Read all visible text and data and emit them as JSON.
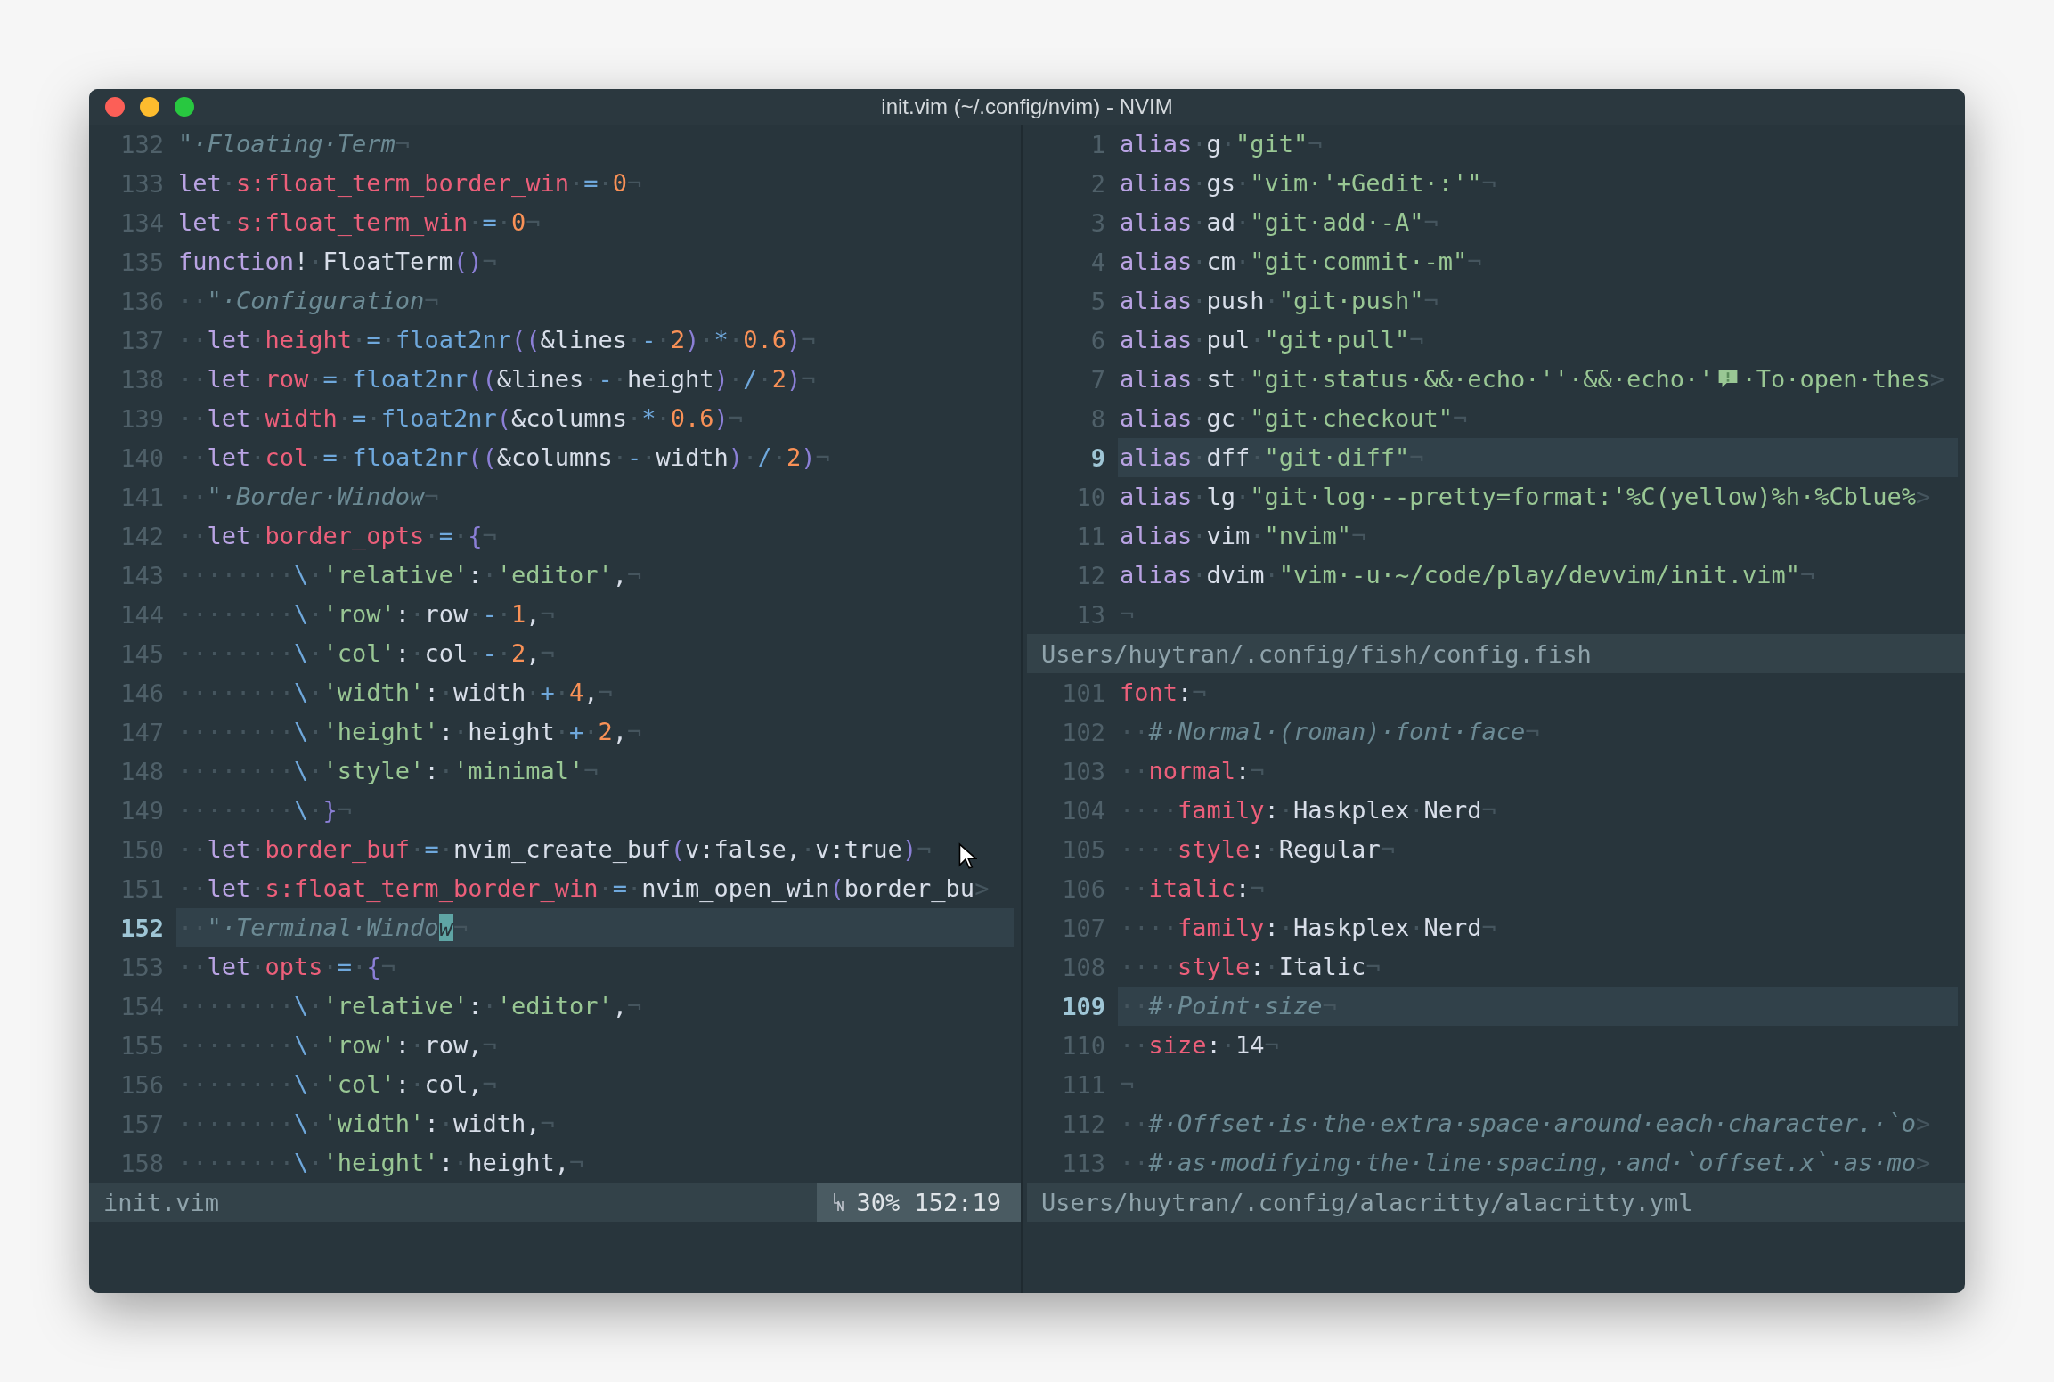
{
  "window": {
    "title": "init.vim (~/.config/nvim) - NVIM"
  },
  "left_pane": {
    "lines": [
      {
        "n": "132",
        "current": false,
        "c": [
          {
            "kind": "cmt",
            "text": "\"·Floating·Term"
          },
          {
            "kind": "ws",
            "text": "¬"
          }
        ]
      },
      {
        "n": "133",
        "current": false,
        "c": [
          {
            "kind": "kw",
            "text": "let"
          },
          {
            "kind": "ws",
            "text": "·"
          },
          {
            "kind": "var",
            "text": "s:float_term_border_win"
          },
          {
            "kind": "ws",
            "text": "·"
          },
          {
            "kind": "op",
            "text": "="
          },
          {
            "kind": "ws",
            "text": "·"
          },
          {
            "kind": "num",
            "text": "0"
          },
          {
            "kind": "ws",
            "text": "¬"
          }
        ]
      },
      {
        "n": "134",
        "current": false,
        "c": [
          {
            "kind": "kw",
            "text": "let"
          },
          {
            "kind": "ws",
            "text": "·"
          },
          {
            "kind": "var",
            "text": "s:float_term_win"
          },
          {
            "kind": "ws",
            "text": "·"
          },
          {
            "kind": "op",
            "text": "="
          },
          {
            "kind": "ws",
            "text": "·"
          },
          {
            "kind": "num",
            "text": "0"
          },
          {
            "kind": "ws",
            "text": "¬"
          }
        ]
      },
      {
        "n": "135",
        "current": false,
        "c": [
          {
            "kind": "kw",
            "text": "function"
          },
          {
            "kind": "tx",
            "text": "!"
          },
          {
            "kind": "ws",
            "text": "·"
          },
          {
            "kind": "tx",
            "text": "FloatTerm"
          },
          {
            "kind": "pn",
            "text": "()"
          },
          {
            "kind": "ws",
            "text": "¬"
          }
        ]
      },
      {
        "n": "136",
        "current": false,
        "c": [
          {
            "kind": "ws",
            "text": "··"
          },
          {
            "kind": "cmt",
            "text": "\"·Configuration"
          },
          {
            "kind": "ws",
            "text": "¬"
          }
        ]
      },
      {
        "n": "137",
        "current": false,
        "c": [
          {
            "kind": "ws",
            "text": "··"
          },
          {
            "kind": "kw",
            "text": "let"
          },
          {
            "kind": "ws",
            "text": "·"
          },
          {
            "kind": "var",
            "text": "height"
          },
          {
            "kind": "ws",
            "text": "·"
          },
          {
            "kind": "op",
            "text": "="
          },
          {
            "kind": "ws",
            "text": "·"
          },
          {
            "kind": "fn",
            "text": "float2nr"
          },
          {
            "kind": "pn",
            "text": "(("
          },
          {
            "kind": "tx",
            "text": "&lines"
          },
          {
            "kind": "ws",
            "text": "·"
          },
          {
            "kind": "op",
            "text": "-"
          },
          {
            "kind": "ws",
            "text": "·"
          },
          {
            "kind": "num",
            "text": "2"
          },
          {
            "kind": "pn",
            "text": ")"
          },
          {
            "kind": "ws",
            "text": "·"
          },
          {
            "kind": "op",
            "text": "*"
          },
          {
            "kind": "ws",
            "text": "·"
          },
          {
            "kind": "num",
            "text": "0.6"
          },
          {
            "kind": "pn",
            "text": ")"
          },
          {
            "kind": "ws",
            "text": "¬"
          }
        ]
      },
      {
        "n": "138",
        "current": false,
        "c": [
          {
            "kind": "ws",
            "text": "··"
          },
          {
            "kind": "kw",
            "text": "let"
          },
          {
            "kind": "ws",
            "text": "·"
          },
          {
            "kind": "var",
            "text": "row"
          },
          {
            "kind": "ws",
            "text": "·"
          },
          {
            "kind": "op",
            "text": "="
          },
          {
            "kind": "ws",
            "text": "·"
          },
          {
            "kind": "fn",
            "text": "float2nr"
          },
          {
            "kind": "pn",
            "text": "(("
          },
          {
            "kind": "tx",
            "text": "&lines"
          },
          {
            "kind": "ws",
            "text": "·"
          },
          {
            "kind": "op",
            "text": "-"
          },
          {
            "kind": "ws",
            "text": "·"
          },
          {
            "kind": "tx",
            "text": "height"
          },
          {
            "kind": "pn",
            "text": ")"
          },
          {
            "kind": "ws",
            "text": "·"
          },
          {
            "kind": "op",
            "text": "/"
          },
          {
            "kind": "ws",
            "text": "·"
          },
          {
            "kind": "num",
            "text": "2"
          },
          {
            "kind": "pn",
            "text": ")"
          },
          {
            "kind": "ws",
            "text": "¬"
          }
        ]
      },
      {
        "n": "139",
        "current": false,
        "c": [
          {
            "kind": "ws",
            "text": "··"
          },
          {
            "kind": "kw",
            "text": "let"
          },
          {
            "kind": "ws",
            "text": "·"
          },
          {
            "kind": "var",
            "text": "width"
          },
          {
            "kind": "ws",
            "text": "·"
          },
          {
            "kind": "op",
            "text": "="
          },
          {
            "kind": "ws",
            "text": "·"
          },
          {
            "kind": "fn",
            "text": "float2nr"
          },
          {
            "kind": "pn",
            "text": "("
          },
          {
            "kind": "tx",
            "text": "&columns"
          },
          {
            "kind": "ws",
            "text": "·"
          },
          {
            "kind": "op",
            "text": "*"
          },
          {
            "kind": "ws",
            "text": "·"
          },
          {
            "kind": "num",
            "text": "0.6"
          },
          {
            "kind": "pn",
            "text": ")"
          },
          {
            "kind": "ws",
            "text": "¬"
          }
        ]
      },
      {
        "n": "140",
        "current": false,
        "c": [
          {
            "kind": "ws",
            "text": "··"
          },
          {
            "kind": "kw",
            "text": "let"
          },
          {
            "kind": "ws",
            "text": "·"
          },
          {
            "kind": "var",
            "text": "col"
          },
          {
            "kind": "ws",
            "text": "·"
          },
          {
            "kind": "op",
            "text": "="
          },
          {
            "kind": "ws",
            "text": "·"
          },
          {
            "kind": "fn",
            "text": "float2nr"
          },
          {
            "kind": "pn",
            "text": "(("
          },
          {
            "kind": "tx",
            "text": "&columns"
          },
          {
            "kind": "ws",
            "text": "·"
          },
          {
            "kind": "op",
            "text": "-"
          },
          {
            "kind": "ws",
            "text": "·"
          },
          {
            "kind": "tx",
            "text": "width"
          },
          {
            "kind": "pn",
            "text": ")"
          },
          {
            "kind": "ws",
            "text": "·"
          },
          {
            "kind": "op",
            "text": "/"
          },
          {
            "kind": "ws",
            "text": "·"
          },
          {
            "kind": "num",
            "text": "2"
          },
          {
            "kind": "pn",
            "text": ")"
          },
          {
            "kind": "ws",
            "text": "¬"
          }
        ]
      },
      {
        "n": "141",
        "current": false,
        "c": [
          {
            "kind": "ws",
            "text": "··"
          },
          {
            "kind": "cmt",
            "text": "\"·Border·Window"
          },
          {
            "kind": "ws",
            "text": "¬"
          }
        ]
      },
      {
        "n": "142",
        "current": false,
        "c": [
          {
            "kind": "ws",
            "text": "··"
          },
          {
            "kind": "kw",
            "text": "let"
          },
          {
            "kind": "ws",
            "text": "·"
          },
          {
            "kind": "var",
            "text": "border_opts"
          },
          {
            "kind": "ws",
            "text": "·"
          },
          {
            "kind": "op",
            "text": "="
          },
          {
            "kind": "ws",
            "text": "·"
          },
          {
            "kind": "pn",
            "text": "{"
          },
          {
            "kind": "ws",
            "text": "¬"
          }
        ]
      },
      {
        "n": "143",
        "current": false,
        "c": [
          {
            "kind": "ws",
            "text": "········"
          },
          {
            "kind": "op",
            "text": "\\"
          },
          {
            "kind": "ws",
            "text": "·"
          },
          {
            "kind": "str",
            "text": "'relative'"
          },
          {
            "kind": "tx",
            "text": ":"
          },
          {
            "kind": "ws",
            "text": "·"
          },
          {
            "kind": "str",
            "text": "'editor'"
          },
          {
            "kind": "tx",
            "text": ","
          },
          {
            "kind": "ws",
            "text": "¬"
          }
        ]
      },
      {
        "n": "144",
        "current": false,
        "c": [
          {
            "kind": "ws",
            "text": "········"
          },
          {
            "kind": "op",
            "text": "\\"
          },
          {
            "kind": "ws",
            "text": "·"
          },
          {
            "kind": "str",
            "text": "'row'"
          },
          {
            "kind": "tx",
            "text": ":"
          },
          {
            "kind": "ws",
            "text": "·"
          },
          {
            "kind": "tx",
            "text": "row"
          },
          {
            "kind": "ws",
            "text": "·"
          },
          {
            "kind": "op",
            "text": "-"
          },
          {
            "kind": "ws",
            "text": "·"
          },
          {
            "kind": "num",
            "text": "1"
          },
          {
            "kind": "tx",
            "text": ","
          },
          {
            "kind": "ws",
            "text": "¬"
          }
        ]
      },
      {
        "n": "145",
        "current": false,
        "c": [
          {
            "kind": "ws",
            "text": "········"
          },
          {
            "kind": "op",
            "text": "\\"
          },
          {
            "kind": "ws",
            "text": "·"
          },
          {
            "kind": "str",
            "text": "'col'"
          },
          {
            "kind": "tx",
            "text": ":"
          },
          {
            "kind": "ws",
            "text": "·"
          },
          {
            "kind": "tx",
            "text": "col"
          },
          {
            "kind": "ws",
            "text": "·"
          },
          {
            "kind": "op",
            "text": "-"
          },
          {
            "kind": "ws",
            "text": "·"
          },
          {
            "kind": "num",
            "text": "2"
          },
          {
            "kind": "tx",
            "text": ","
          },
          {
            "kind": "ws",
            "text": "¬"
          }
        ]
      },
      {
        "n": "146",
        "current": false,
        "c": [
          {
            "kind": "ws",
            "text": "········"
          },
          {
            "kind": "op",
            "text": "\\"
          },
          {
            "kind": "ws",
            "text": "·"
          },
          {
            "kind": "str",
            "text": "'width'"
          },
          {
            "kind": "tx",
            "text": ":"
          },
          {
            "kind": "ws",
            "text": "·"
          },
          {
            "kind": "tx",
            "text": "width"
          },
          {
            "kind": "ws",
            "text": "·"
          },
          {
            "kind": "op",
            "text": "+"
          },
          {
            "kind": "ws",
            "text": "·"
          },
          {
            "kind": "num",
            "text": "4"
          },
          {
            "kind": "tx",
            "text": ","
          },
          {
            "kind": "ws",
            "text": "¬"
          }
        ]
      },
      {
        "n": "147",
        "current": false,
        "c": [
          {
            "kind": "ws",
            "text": "········"
          },
          {
            "kind": "op",
            "text": "\\"
          },
          {
            "kind": "ws",
            "text": "·"
          },
          {
            "kind": "str",
            "text": "'height'"
          },
          {
            "kind": "tx",
            "text": ":"
          },
          {
            "kind": "ws",
            "text": "·"
          },
          {
            "kind": "tx",
            "text": "height"
          },
          {
            "kind": "ws",
            "text": "·"
          },
          {
            "kind": "op",
            "text": "+"
          },
          {
            "kind": "ws",
            "text": "·"
          },
          {
            "kind": "num",
            "text": "2"
          },
          {
            "kind": "tx",
            "text": ","
          },
          {
            "kind": "ws",
            "text": "¬"
          }
        ]
      },
      {
        "n": "148",
        "current": false,
        "c": [
          {
            "kind": "ws",
            "text": "········"
          },
          {
            "kind": "op",
            "text": "\\"
          },
          {
            "kind": "ws",
            "text": "·"
          },
          {
            "kind": "str",
            "text": "'style'"
          },
          {
            "kind": "tx",
            "text": ":"
          },
          {
            "kind": "ws",
            "text": "·"
          },
          {
            "kind": "str",
            "text": "'minimal'"
          },
          {
            "kind": "ws",
            "text": "¬"
          }
        ]
      },
      {
        "n": "149",
        "current": false,
        "c": [
          {
            "kind": "ws",
            "text": "········"
          },
          {
            "kind": "op",
            "text": "\\"
          },
          {
            "kind": "ws",
            "text": "·"
          },
          {
            "kind": "pn",
            "text": "}"
          },
          {
            "kind": "ws",
            "text": "¬"
          }
        ]
      },
      {
        "n": "150",
        "current": false,
        "c": [
          {
            "kind": "ws",
            "text": "··"
          },
          {
            "kind": "kw",
            "text": "let"
          },
          {
            "kind": "ws",
            "text": "·"
          },
          {
            "kind": "var",
            "text": "border_buf"
          },
          {
            "kind": "ws",
            "text": "·"
          },
          {
            "kind": "op",
            "text": "="
          },
          {
            "kind": "ws",
            "text": "·"
          },
          {
            "kind": "tx",
            "text": "nvim_create_buf"
          },
          {
            "kind": "pn",
            "text": "("
          },
          {
            "kind": "tx",
            "text": "v:false,"
          },
          {
            "kind": "ws",
            "text": "·"
          },
          {
            "kind": "tx",
            "text": "v:true"
          },
          {
            "kind": "pn",
            "text": ")"
          },
          {
            "kind": "ws",
            "text": "¬"
          }
        ]
      },
      {
        "n": "151",
        "current": false,
        "c": [
          {
            "kind": "ws",
            "text": "··"
          },
          {
            "kind": "kw",
            "text": "let"
          },
          {
            "kind": "ws",
            "text": "·"
          },
          {
            "kind": "var",
            "text": "s:float_term_border_win"
          },
          {
            "kind": "ws",
            "text": "·"
          },
          {
            "kind": "op",
            "text": "="
          },
          {
            "kind": "ws",
            "text": "·"
          },
          {
            "kind": "tx",
            "text": "nvim_open_win"
          },
          {
            "kind": "pn",
            "text": "("
          },
          {
            "kind": "tx",
            "text": "border_bu"
          },
          {
            "kind": "ws",
            "text": ">"
          }
        ]
      },
      {
        "n": "152",
        "current": true,
        "c": [
          {
            "kind": "ws",
            "text": "··"
          },
          {
            "kind": "cmt",
            "text": "\"·Terminal·Windo"
          },
          {
            "kind": "cur",
            "text": "w"
          },
          {
            "kind": "ws",
            "text": "¬"
          }
        ]
      },
      {
        "n": "153",
        "current": false,
        "c": [
          {
            "kind": "ws",
            "text": "··"
          },
          {
            "kind": "kw",
            "text": "let"
          },
          {
            "kind": "ws",
            "text": "·"
          },
          {
            "kind": "var",
            "text": "opts"
          },
          {
            "kind": "ws",
            "text": "·"
          },
          {
            "kind": "op",
            "text": "="
          },
          {
            "kind": "ws",
            "text": "·"
          },
          {
            "kind": "pn",
            "text": "{"
          },
          {
            "kind": "ws",
            "text": "¬"
          }
        ]
      },
      {
        "n": "154",
        "current": false,
        "c": [
          {
            "kind": "ws",
            "text": "········"
          },
          {
            "kind": "op",
            "text": "\\"
          },
          {
            "kind": "ws",
            "text": "·"
          },
          {
            "kind": "str",
            "text": "'relative'"
          },
          {
            "kind": "tx",
            "text": ":"
          },
          {
            "kind": "ws",
            "text": "·"
          },
          {
            "kind": "str",
            "text": "'editor'"
          },
          {
            "kind": "tx",
            "text": ","
          },
          {
            "kind": "ws",
            "text": "¬"
          }
        ]
      },
      {
        "n": "155",
        "current": false,
        "c": [
          {
            "kind": "ws",
            "text": "········"
          },
          {
            "kind": "op",
            "text": "\\"
          },
          {
            "kind": "ws",
            "text": "·"
          },
          {
            "kind": "str",
            "text": "'row'"
          },
          {
            "kind": "tx",
            "text": ":"
          },
          {
            "kind": "ws",
            "text": "·"
          },
          {
            "kind": "tx",
            "text": "row,"
          },
          {
            "kind": "ws",
            "text": "¬"
          }
        ]
      },
      {
        "n": "156",
        "current": false,
        "c": [
          {
            "kind": "ws",
            "text": "········"
          },
          {
            "kind": "op",
            "text": "\\"
          },
          {
            "kind": "ws",
            "text": "·"
          },
          {
            "kind": "str",
            "text": "'col'"
          },
          {
            "kind": "tx",
            "text": ":"
          },
          {
            "kind": "ws",
            "text": "·"
          },
          {
            "kind": "tx",
            "text": "col,"
          },
          {
            "kind": "ws",
            "text": "¬"
          }
        ]
      },
      {
        "n": "157",
        "current": false,
        "c": [
          {
            "kind": "ws",
            "text": "········"
          },
          {
            "kind": "op",
            "text": "\\"
          },
          {
            "kind": "ws",
            "text": "·"
          },
          {
            "kind": "str",
            "text": "'width'"
          },
          {
            "kind": "tx",
            "text": ":"
          },
          {
            "kind": "ws",
            "text": "·"
          },
          {
            "kind": "tx",
            "text": "width,"
          },
          {
            "kind": "ws",
            "text": "¬"
          }
        ]
      },
      {
        "n": "158",
        "current": false,
        "c": [
          {
            "kind": "ws",
            "text": "········"
          },
          {
            "kind": "op",
            "text": "\\"
          },
          {
            "kind": "ws",
            "text": "·"
          },
          {
            "kind": "str",
            "text": "'height'"
          },
          {
            "kind": "tx",
            "text": ":"
          },
          {
            "kind": "ws",
            "text": "·"
          },
          {
            "kind": "tx",
            "text": "height,"
          },
          {
            "kind": "ws",
            "text": "¬"
          }
        ]
      }
    ],
    "status": {
      "file": "init.vim",
      "position": "30% 152:19"
    }
  },
  "right_pane": {
    "sections": [
      {
        "lines": [
          {
            "n": "1",
            "current": false,
            "c": [
              {
                "kind": "kw",
                "text": "alias"
              },
              {
                "kind": "ws",
                "text": "·"
              },
              {
                "kind": "tx",
                "text": "g"
              },
              {
                "kind": "ws",
                "text": "·"
              },
              {
                "kind": "str",
                "text": "\"git\""
              },
              {
                "kind": "ws",
                "text": "¬"
              }
            ]
          },
          {
            "n": "2",
            "current": false,
            "c": [
              {
                "kind": "kw",
                "text": "alias"
              },
              {
                "kind": "ws",
                "text": "·"
              },
              {
                "kind": "tx",
                "text": "gs"
              },
              {
                "kind": "ws",
                "text": "·"
              },
              {
                "kind": "str",
                "text": "\"vim·'+Gedit·:'\""
              },
              {
                "kind": "ws",
                "text": "¬"
              }
            ]
          },
          {
            "n": "3",
            "current": false,
            "c": [
              {
                "kind": "kw",
                "text": "alias"
              },
              {
                "kind": "ws",
                "text": "·"
              },
              {
                "kind": "tx",
                "text": "ad"
              },
              {
                "kind": "ws",
                "text": "·"
              },
              {
                "kind": "str",
                "text": "\"git·add·-A\""
              },
              {
                "kind": "ws",
                "text": "¬"
              }
            ]
          },
          {
            "n": "4",
            "current": false,
            "c": [
              {
                "kind": "kw",
                "text": "alias"
              },
              {
                "kind": "ws",
                "text": "·"
              },
              {
                "kind": "tx",
                "text": "cm"
              },
              {
                "kind": "ws",
                "text": "·"
              },
              {
                "kind": "str",
                "text": "\"git·commit·-m\""
              },
              {
                "kind": "ws",
                "text": "¬"
              }
            ]
          },
          {
            "n": "5",
            "current": false,
            "c": [
              {
                "kind": "kw",
                "text": "alias"
              },
              {
                "kind": "ws",
                "text": "·"
              },
              {
                "kind": "tx",
                "text": "push"
              },
              {
                "kind": "ws",
                "text": "·"
              },
              {
                "kind": "str",
                "text": "\"git·push\""
              },
              {
                "kind": "ws",
                "text": "¬"
              }
            ]
          },
          {
            "n": "6",
            "current": false,
            "c": [
              {
                "kind": "kw",
                "text": "alias"
              },
              {
                "kind": "ws",
                "text": "·"
              },
              {
                "kind": "tx",
                "text": "pul"
              },
              {
                "kind": "ws",
                "text": "·"
              },
              {
                "kind": "str",
                "text": "\"git·pull\""
              },
              {
                "kind": "ws",
                "text": "¬"
              }
            ]
          },
          {
            "n": "7",
            "current": false,
            "c": [
              {
                "kind": "kw",
                "text": "alias"
              },
              {
                "kind": "ws",
                "text": "·"
              },
              {
                "kind": "tx",
                "text": "st"
              },
              {
                "kind": "ws",
                "text": "·"
              },
              {
                "kind": "str",
                "text": "\"git·status·&&·echo·''·&&·echo·'"
              },
              {
                "kind": "icon"
              },
              {
                "kind": "str",
                "text": "·To·open·thes"
              },
              {
                "kind": "ws",
                "text": ">"
              }
            ]
          },
          {
            "n": "8",
            "current": false,
            "c": [
              {
                "kind": "kw",
                "text": "alias"
              },
              {
                "kind": "ws",
                "text": "·"
              },
              {
                "kind": "tx",
                "text": "gc"
              },
              {
                "kind": "ws",
                "text": "·"
              },
              {
                "kind": "str",
                "text": "\"git·checkout\""
              },
              {
                "kind": "ws",
                "text": "¬"
              }
            ]
          },
          {
            "n": "9",
            "current": true,
            "c": [
              {
                "kind": "kw",
                "text": "alias"
              },
              {
                "kind": "ws",
                "text": "·"
              },
              {
                "kind": "tx",
                "text": "dff"
              },
              {
                "kind": "ws",
                "text": "·"
              },
              {
                "kind": "str",
                "text": "\"git·diff\""
              },
              {
                "kind": "ws",
                "text": "¬"
              }
            ]
          },
          {
            "n": "10",
            "current": false,
            "c": [
              {
                "kind": "kw",
                "text": "alias"
              },
              {
                "kind": "ws",
                "text": "·"
              },
              {
                "kind": "tx",
                "text": "lg"
              },
              {
                "kind": "ws",
                "text": "·"
              },
              {
                "kind": "str",
                "text": "\"git·log·--pretty=format:'%C(yellow)%h·%Cblue%"
              },
              {
                "kind": "ws",
                "text": ">"
              }
            ]
          },
          {
            "n": "11",
            "current": false,
            "c": [
              {
                "kind": "kw",
                "text": "alias"
              },
              {
                "kind": "ws",
                "text": "·"
              },
              {
                "kind": "tx",
                "text": "vim"
              },
              {
                "kind": "ws",
                "text": "·"
              },
              {
                "kind": "str",
                "text": "\"nvim\""
              },
              {
                "kind": "ws",
                "text": "¬"
              }
            ]
          },
          {
            "n": "12",
            "current": false,
            "c": [
              {
                "kind": "kw",
                "text": "alias"
              },
              {
                "kind": "ws",
                "text": "·"
              },
              {
                "kind": "tx",
                "text": "dvim"
              },
              {
                "kind": "ws",
                "text": "·"
              },
              {
                "kind": "str",
                "text": "\"vim·-u·~/code/play/devvim/init.vim\""
              },
              {
                "kind": "ws",
                "text": "¬"
              }
            ]
          },
          {
            "n": "13",
            "current": false,
            "c": [
              {
                "kind": "ws",
                "text": "¬"
              }
            ]
          }
        ],
        "status": {
          "file": "Users/huytran/.config/fish/config.fish"
        }
      },
      {
        "lines": [
          {
            "n": "101",
            "current": false,
            "c": [
              {
                "kind": "var",
                "text": "font"
              },
              {
                "kind": "tx",
                "text": ":"
              },
              {
                "kind": "ws",
                "text": "¬"
              }
            ]
          },
          {
            "n": "102",
            "current": false,
            "c": [
              {
                "kind": "ws",
                "text": "··"
              },
              {
                "kind": "cmt",
                "text": "#·Normal·(roman)·font·face"
              },
              {
                "kind": "ws",
                "text": "¬"
              }
            ]
          },
          {
            "n": "103",
            "current": false,
            "c": [
              {
                "kind": "ws",
                "text": "··"
              },
              {
                "kind": "var",
                "text": "normal"
              },
              {
                "kind": "tx",
                "text": ":"
              },
              {
                "kind": "ws",
                "text": "¬"
              }
            ]
          },
          {
            "n": "104",
            "current": false,
            "c": [
              {
                "kind": "ws",
                "text": "····"
              },
              {
                "kind": "var",
                "text": "family"
              },
              {
                "kind": "tx",
                "text": ":"
              },
              {
                "kind": "ws",
                "text": "·"
              },
              {
                "kind": "tx",
                "text": "Haskplex"
              },
              {
                "kind": "ws",
                "text": "·"
              },
              {
                "kind": "tx",
                "text": "Nerd"
              },
              {
                "kind": "ws",
                "text": "¬"
              }
            ]
          },
          {
            "n": "105",
            "current": false,
            "c": [
              {
                "kind": "ws",
                "text": "····"
              },
              {
                "kind": "var",
                "text": "style"
              },
              {
                "kind": "tx",
                "text": ":"
              },
              {
                "kind": "ws",
                "text": "·"
              },
              {
                "kind": "tx",
                "text": "Regular"
              },
              {
                "kind": "ws",
                "text": "¬"
              }
            ]
          },
          {
            "n": "106",
            "current": false,
            "c": [
              {
                "kind": "ws",
                "text": "··"
              },
              {
                "kind": "var",
                "text": "italic"
              },
              {
                "kind": "tx",
                "text": ":"
              },
              {
                "kind": "ws",
                "text": "¬"
              }
            ]
          },
          {
            "n": "107",
            "current": false,
            "c": [
              {
                "kind": "ws",
                "text": "····"
              },
              {
                "kind": "var",
                "text": "family"
              },
              {
                "kind": "tx",
                "text": ":"
              },
              {
                "kind": "ws",
                "text": "·"
              },
              {
                "kind": "tx",
                "text": "Haskplex"
              },
              {
                "kind": "ws",
                "text": "·"
              },
              {
                "kind": "tx",
                "text": "Nerd"
              },
              {
                "kind": "ws",
                "text": "¬"
              }
            ]
          },
          {
            "n": "108",
            "current": false,
            "c": [
              {
                "kind": "ws",
                "text": "····"
              },
              {
                "kind": "var",
                "text": "style"
              },
              {
                "kind": "tx",
                "text": ":"
              },
              {
                "kind": "ws",
                "text": "·"
              },
              {
                "kind": "tx",
                "text": "Italic"
              },
              {
                "kind": "ws",
                "text": "¬"
              }
            ]
          },
          {
            "n": "109",
            "current": true,
            "c": [
              {
                "kind": "ws",
                "text": "··"
              },
              {
                "kind": "cmt",
                "text": "#·Point·size"
              },
              {
                "kind": "ws",
                "text": "¬"
              }
            ]
          },
          {
            "n": "110",
            "current": false,
            "c": [
              {
                "kind": "ws",
                "text": "··"
              },
              {
                "kind": "var",
                "text": "size"
              },
              {
                "kind": "tx",
                "text": ":"
              },
              {
                "kind": "ws",
                "text": "·"
              },
              {
                "kind": "tx",
                "text": "14"
              },
              {
                "kind": "ws",
                "text": "¬"
              }
            ]
          },
          {
            "n": "111",
            "current": false,
            "c": [
              {
                "kind": "ws",
                "text": "¬"
              }
            ]
          },
          {
            "n": "112",
            "current": false,
            "c": [
              {
                "kind": "ws",
                "text": "··"
              },
              {
                "kind": "cmt",
                "text": "#·Offset·is·the·extra·space·around·each·character.·`o"
              },
              {
                "kind": "ws",
                "text": ">"
              }
            ]
          },
          {
            "n": "113",
            "current": false,
            "c": [
              {
                "kind": "ws",
                "text": "··"
              },
              {
                "kind": "cmt",
                "text": "#·as·modifying·the·line·spacing,·and·`offset.x`·as·mo"
              },
              {
                "kind": "ws",
                "text": ">"
              }
            ]
          }
        ],
        "status": {
          "file": "Users/huytran/.config/alacritty/alacritty.yml"
        }
      }
    ]
  }
}
